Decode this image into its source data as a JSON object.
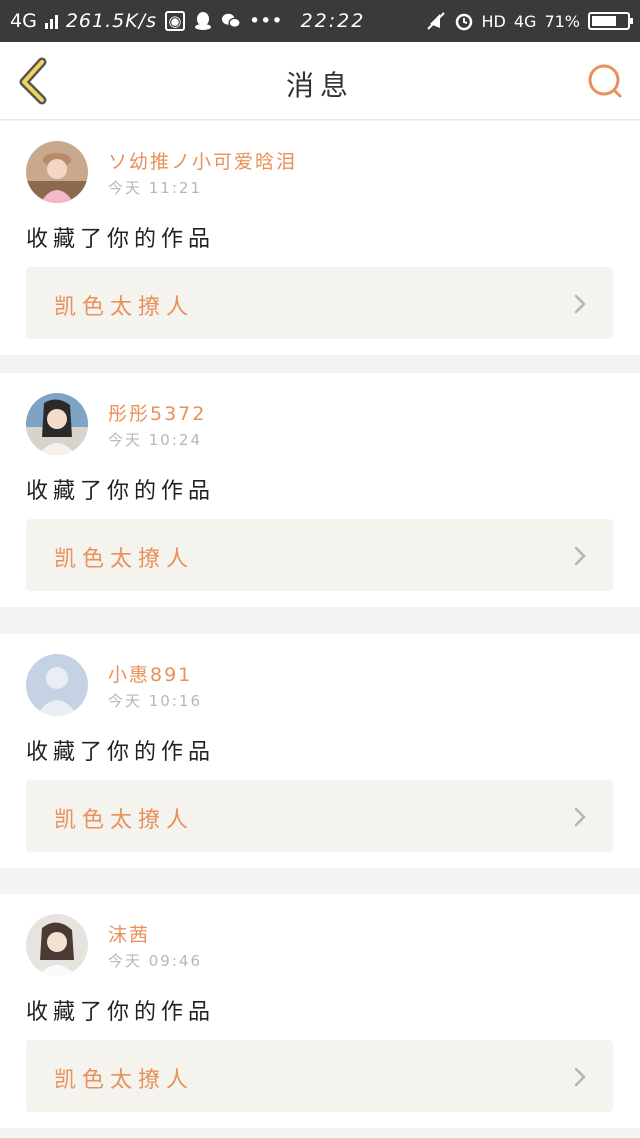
{
  "status_bar": {
    "network": "4G",
    "speed": "261.5K/s",
    "time": "22:22",
    "hd": "HD",
    "network2": "4G",
    "battery": "71%",
    "battery_level": 0.71
  },
  "header": {
    "title": "消息",
    "accent_color": "#e8915a"
  },
  "messages": [
    {
      "username": "ソ幼推ノ小可爱晗泪",
      "time": "今天 11:21",
      "action": "收藏了你的作品",
      "work_title": "凯色太撩人"
    },
    {
      "username": "彤彤5372",
      "time": "今天 10:24",
      "action": "收藏了你的作品",
      "work_title": "凯色太撩人"
    },
    {
      "username": "小惠891",
      "time": "今天 10:16",
      "action": "收藏了你的作品",
      "work_title": "凯色太撩人"
    },
    {
      "username": "沫茜",
      "time": "今天 09:46",
      "action": "收藏了你的作品",
      "work_title": "凯色太撩人"
    }
  ]
}
